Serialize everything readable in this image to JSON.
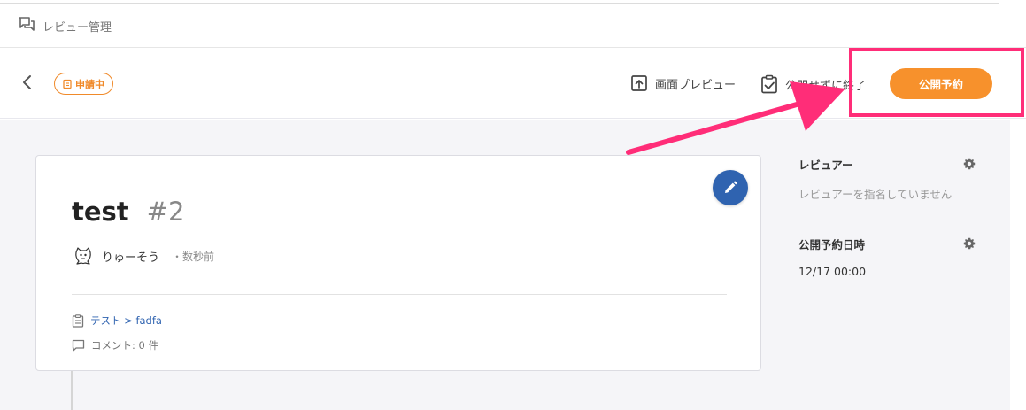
{
  "breadcrumb": {
    "label": "レビュー管理"
  },
  "header": {
    "status_badge": "申請中",
    "preview_label": "画面プレビュー",
    "finish_label": "公開せずに終了",
    "publish_label": "公開予約"
  },
  "review": {
    "title": "test",
    "number": "#2",
    "author": "りゅーそう",
    "time": "・数秒前",
    "path_link": "テスト > fadfa",
    "comments": "コメント: 0 件"
  },
  "sidebar": {
    "reviewer_label": "レビュアー",
    "reviewer_value": "レビュアーを指名していません",
    "schedule_label": "公開予約日時",
    "schedule_value": "12/17 00:00"
  },
  "colors": {
    "accent": "#f7912c",
    "edit_button": "#2f63b0",
    "annotation": "#ff2d78"
  }
}
